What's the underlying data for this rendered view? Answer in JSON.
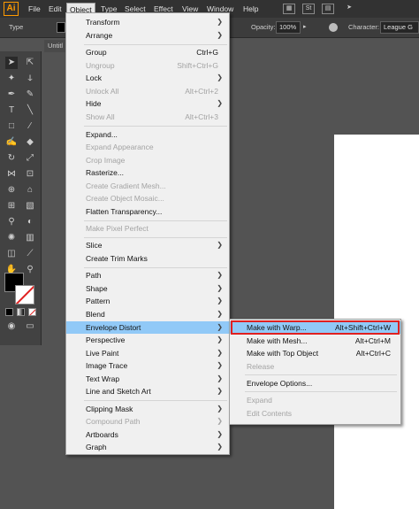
{
  "app": {
    "logo": "Ai",
    "menus": [
      "File",
      "Edit",
      "Object",
      "Type",
      "Select",
      "Effect",
      "View",
      "Window",
      "Help"
    ],
    "active_menu": "Object",
    "menubar_icons": [
      "St"
    ]
  },
  "control_bar": {
    "type_label": "Type",
    "opacity_label": "Opacity:",
    "opacity_value": "100%",
    "character_label": "Character:",
    "font_value": "League G"
  },
  "document": {
    "tab_title": "Untitl"
  },
  "colors": {
    "highlight": "#91c9f7",
    "callout": "#e02020",
    "menu_bg": "#f0f0f0",
    "ui_bg": "#535353"
  },
  "object_menu": {
    "items": [
      {
        "label": "Transform",
        "shortcut": "",
        "submenu": true,
        "disabled": false
      },
      {
        "label": "Arrange",
        "shortcut": "",
        "submenu": true,
        "disabled": false
      },
      {
        "label": "Group",
        "shortcut": "Ctrl+G",
        "submenu": false,
        "disabled": false
      },
      {
        "label": "Ungroup",
        "shortcut": "Shift+Ctrl+G",
        "submenu": false,
        "disabled": true
      },
      {
        "label": "Lock",
        "shortcut": "",
        "submenu": true,
        "disabled": false
      },
      {
        "label": "Unlock All",
        "shortcut": "Alt+Ctrl+2",
        "submenu": false,
        "disabled": true
      },
      {
        "label": "Hide",
        "shortcut": "",
        "submenu": true,
        "disabled": false
      },
      {
        "label": "Show All",
        "shortcut": "Alt+Ctrl+3",
        "submenu": false,
        "disabled": true
      },
      {
        "label": "Expand...",
        "shortcut": "",
        "submenu": false,
        "disabled": false
      },
      {
        "label": "Expand Appearance",
        "shortcut": "",
        "submenu": false,
        "disabled": true
      },
      {
        "label": "Crop Image",
        "shortcut": "",
        "submenu": false,
        "disabled": true
      },
      {
        "label": "Rasterize...",
        "shortcut": "",
        "submenu": false,
        "disabled": false
      },
      {
        "label": "Create Gradient Mesh...",
        "shortcut": "",
        "submenu": false,
        "disabled": true
      },
      {
        "label": "Create Object Mosaic...",
        "shortcut": "",
        "submenu": false,
        "disabled": true
      },
      {
        "label": "Flatten Transparency...",
        "shortcut": "",
        "submenu": false,
        "disabled": false
      },
      {
        "label": "Make Pixel Perfect",
        "shortcut": "",
        "submenu": false,
        "disabled": true
      },
      {
        "label": "Slice",
        "shortcut": "",
        "submenu": true,
        "disabled": false
      },
      {
        "label": "Create Trim Marks",
        "shortcut": "",
        "submenu": false,
        "disabled": false
      },
      {
        "label": "Path",
        "shortcut": "",
        "submenu": true,
        "disabled": false
      },
      {
        "label": "Shape",
        "shortcut": "",
        "submenu": true,
        "disabled": false
      },
      {
        "label": "Pattern",
        "shortcut": "",
        "submenu": true,
        "disabled": false
      },
      {
        "label": "Blend",
        "shortcut": "",
        "submenu": true,
        "disabled": false
      },
      {
        "label": "Envelope Distort",
        "shortcut": "",
        "submenu": true,
        "disabled": false,
        "highlighted": true
      },
      {
        "label": "Perspective",
        "shortcut": "",
        "submenu": true,
        "disabled": false
      },
      {
        "label": "Live Paint",
        "shortcut": "",
        "submenu": true,
        "disabled": false
      },
      {
        "label": "Image Trace",
        "shortcut": "",
        "submenu": true,
        "disabled": false
      },
      {
        "label": "Text Wrap",
        "shortcut": "",
        "submenu": true,
        "disabled": false
      },
      {
        "label": "Line and Sketch Art",
        "shortcut": "",
        "submenu": true,
        "disabled": false
      },
      {
        "label": "Clipping Mask",
        "shortcut": "",
        "submenu": true,
        "disabled": false
      },
      {
        "label": "Compound Path",
        "shortcut": "",
        "submenu": true,
        "disabled": true
      },
      {
        "label": "Artboards",
        "shortcut": "",
        "submenu": true,
        "disabled": false
      },
      {
        "label": "Graph",
        "shortcut": "",
        "submenu": true,
        "disabled": false
      }
    ]
  },
  "envelope_submenu": {
    "items": [
      {
        "label": "Make with Warp...",
        "shortcut": "Alt+Shift+Ctrl+W",
        "disabled": false,
        "highlighted": true
      },
      {
        "label": "Make with Mesh...",
        "shortcut": "Alt+Ctrl+M",
        "disabled": false
      },
      {
        "label": "Make with Top Object",
        "shortcut": "Alt+Ctrl+C",
        "disabled": false
      },
      {
        "label": "Release",
        "shortcut": "",
        "disabled": true
      },
      {
        "label": "Envelope Options...",
        "shortcut": "",
        "disabled": false
      },
      {
        "label": "Expand",
        "shortcut": "",
        "disabled": true
      },
      {
        "label": "Edit Contents",
        "shortcut": "",
        "disabled": true
      }
    ]
  }
}
